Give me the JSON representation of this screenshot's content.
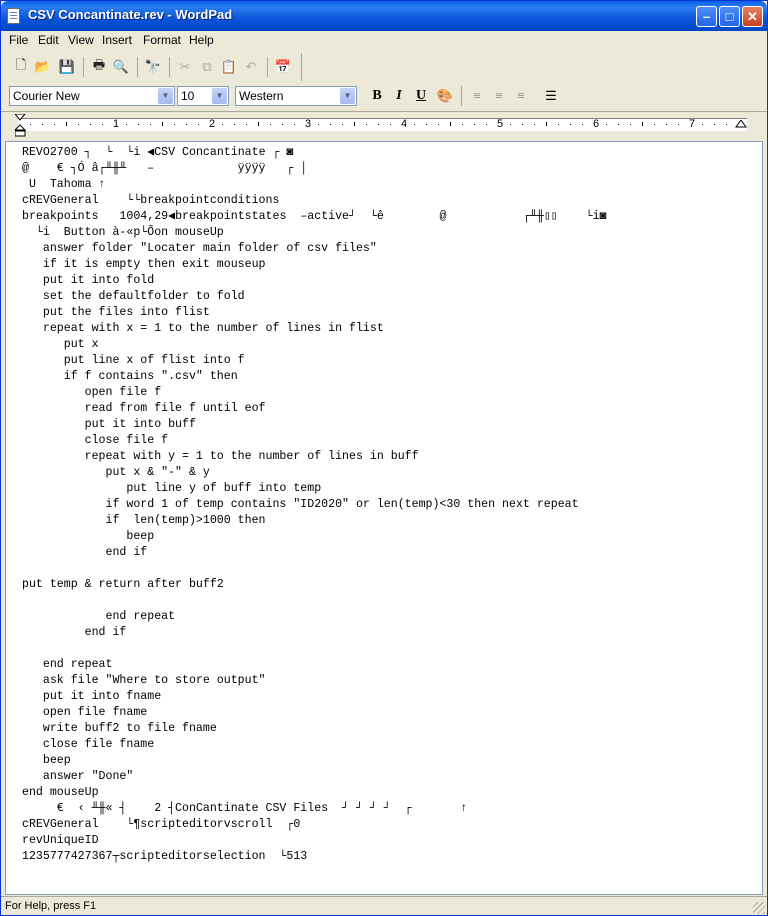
{
  "window": {
    "title": "CSV Concantinate.rev - WordPad"
  },
  "menu": [
    "File",
    "Edit",
    "View",
    "Insert",
    "Format",
    "Help"
  ],
  "format_bar": {
    "font_name": "Courier New",
    "font_size": "10",
    "script": "Western",
    "bold_label": "B",
    "italic_label": "I",
    "underline_label": "U"
  },
  "ruler": {
    "numbers": [
      "1",
      "2",
      "3",
      "4",
      "5",
      "6",
      "7"
    ]
  },
  "document": {
    "lines": [
      "REVO2700 ┐  └  └i ◀CSV Concantinate ┌ ◙",
      "@    € ┐Ó â┌╨╫╨   –            ÿÿÿÿ   ┌ │",
      " U  Tahoma ↑",
      "cREVGeneral    └└breakpointconditions",
      "breakpoints   1004,29◀breakpointstates  –active┘  └ê        @           ┌╨╫▯▯    └i◙",
      "  └i  Button à-«p└Õon mouseUp",
      "   answer folder \"Locater main folder of csv files\"",
      "   if it is empty then exit mouseup",
      "   put it into fold",
      "   set the defaultfolder to fold",
      "   put the files into flist",
      "   repeat with x = 1 to the number of lines in flist",
      "      put x",
      "      put line x of flist into f",
      "      if f contains \".csv\" then",
      "         open file f",
      "         read from file f until eof",
      "         put it into buff",
      "         close file f",
      "         repeat with y = 1 to the number of lines in buff",
      "            put x & \"-\" & y",
      "               put line y of buff into temp",
      "            if word 1 of temp contains \"ID2020\" or len(temp)<30 then next repeat",
      "            if  len(temp)>1000 then",
      "               beep",
      "            end if",
      "",
      "put temp & return after buff2",
      "",
      "            end repeat",
      "         end if",
      "",
      "   end repeat",
      "   ask file \"Where to store output\"",
      "   put it into fname",
      "   open file fname",
      "   write buff2 to file fname",
      "   close file fname",
      "   beep",
      "   answer \"Done\"",
      "end mouseUp",
      "     €  ‹ ╨╫« ┤    2 ┤ConCantinate CSV Files  ┘ ┘ ┘ ┘  ┌       ↑",
      "cREVGeneral    └¶scripteditorvscroll  ┌0",
      "revUniqueID",
      "1235777427367┬scripteditorselection  └513"
    ]
  },
  "status": {
    "text": "For Help, press F1"
  }
}
